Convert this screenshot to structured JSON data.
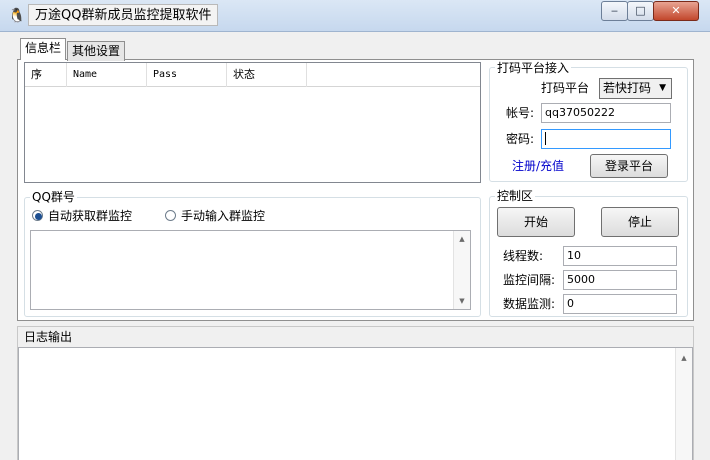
{
  "window": {
    "title": "万途QQ群新成员监控提取软件",
    "app_icon": "penguin-icon",
    "min_glyph": "‒",
    "max_glyph": "□",
    "close_glyph": "✕"
  },
  "tabs": [
    {
      "label": "信息栏",
      "active": true
    },
    {
      "label": "其他设置",
      "active": false
    }
  ],
  "list": {
    "columns": [
      "序",
      "Name",
      "Pass",
      "状态"
    ],
    "rows": []
  },
  "captcha_platform": {
    "group_title": "打码平台接入",
    "platform_label": "打码平台",
    "platform_selected": "若快打码",
    "account_label": "帐号:",
    "account_value": "qq37050222",
    "password_label": "密码:",
    "password_value": "",
    "register_link": "注册/充值",
    "login_button": "登录平台"
  },
  "qq_group": {
    "group_title": "QQ群号",
    "radio_auto": "自动获取群监控",
    "radio_manual": "手动输入群监控",
    "auto_selected": true,
    "textarea_value": ""
  },
  "control": {
    "group_title": "控制区",
    "start_button": "开始",
    "stop_button": "停止",
    "threads_label": "线程数:",
    "threads_value": "10",
    "interval_label": "监控间隔:",
    "interval_value": "5000",
    "data_label": "数据监测:",
    "data_value": "0"
  },
  "log": {
    "title": "日志输出",
    "content": ""
  }
}
